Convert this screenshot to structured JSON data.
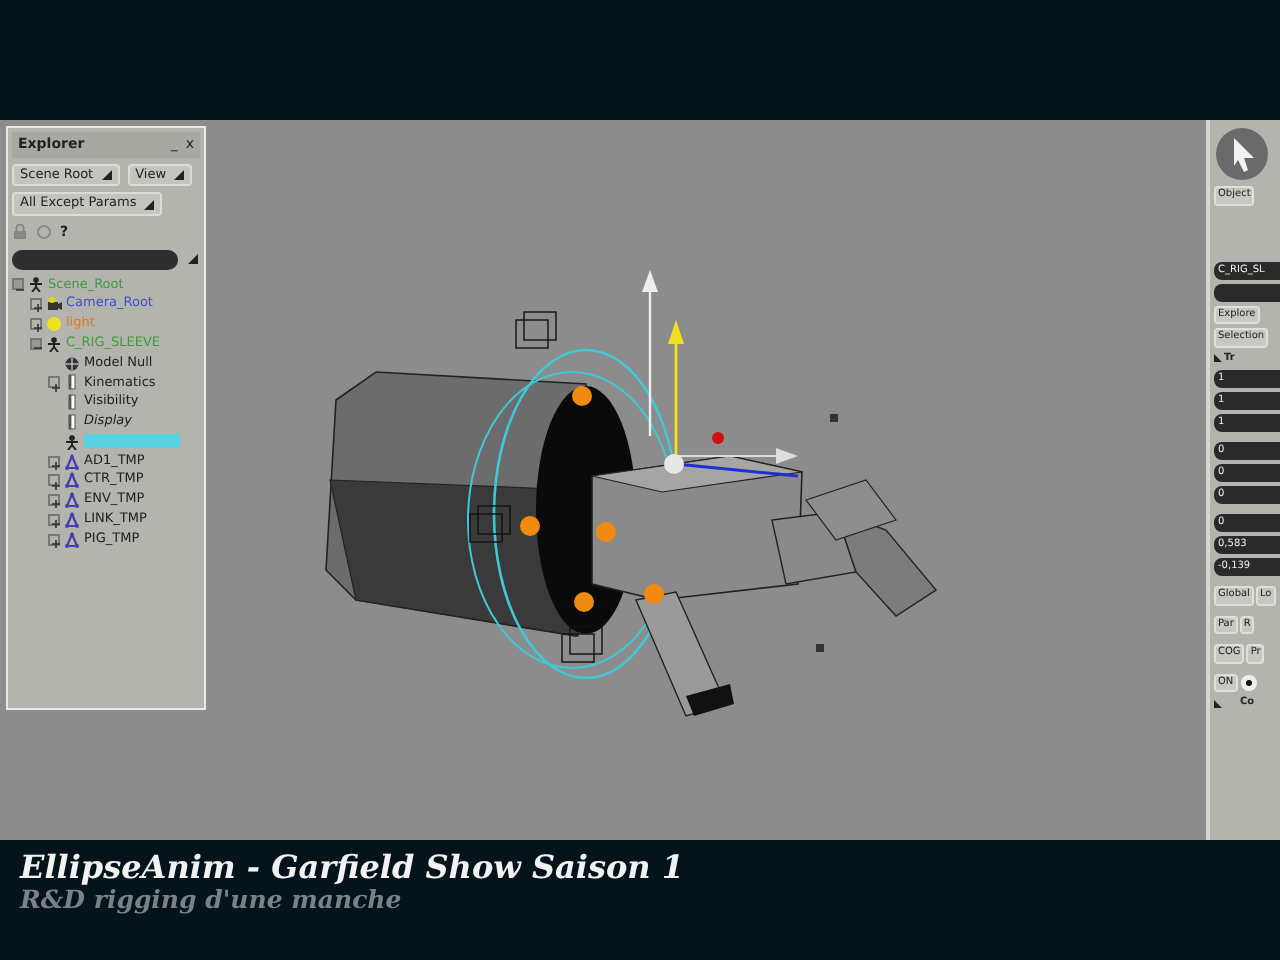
{
  "explorer": {
    "title": "Explorer",
    "minimize": "_",
    "close": "x",
    "buttons": [
      "Scene Root",
      "View",
      "All Except Params"
    ],
    "help": "?",
    "tree": [
      {
        "label": "Scene_Root",
        "kind": "null",
        "color": "#3f9a3f",
        "expanded": true,
        "children": [
          {
            "label": "Camera_Root",
            "kind": "camera",
            "color": "#4050c8",
            "expanded": false
          },
          {
            "label": "light",
            "kind": "light",
            "color": "#e07a20",
            "expanded": false
          },
          {
            "label": "C_RIG_SLEEVE",
            "kind": "null",
            "color": "#3f9a3f",
            "expanded": true,
            "children": [
              {
                "label": "Model Null",
                "kind": "model",
                "color": "#202020"
              },
              {
                "label": "Kinematics",
                "kind": "prop",
                "color": "#202020",
                "expanded": false
              },
              {
                "label": "Visibility",
                "kind": "prop",
                "color": "#202020"
              },
              {
                "label": "Display",
                "kind": "prop",
                "color": "#202020",
                "italic": true
              },
              {
                "kind": "null",
                "selected": true,
                "color": "#5ad0e0"
              },
              {
                "label": "AD1_TMP",
                "kind": "group",
                "color": "#202020",
                "expanded": false
              },
              {
                "label": "CTR_TMP",
                "kind": "group",
                "color": "#202020",
                "expanded": false
              },
              {
                "label": "ENV_TMP",
                "kind": "group",
                "color": "#202020",
                "expanded": false
              },
              {
                "label": "LINK_TMP",
                "kind": "group",
                "color": "#202020",
                "expanded": false
              },
              {
                "label": "PIG_TMP",
                "kind": "group",
                "color": "#202020",
                "expanded": false
              }
            ]
          }
        ]
      }
    ]
  },
  "panel": {
    "tab": "Object",
    "name_field": "C_RIG_SL",
    "buttons": [
      "Explore",
      "Selection"
    ],
    "section": "Tr",
    "values": [
      "1",
      "1",
      "1",
      "0",
      "0",
      "0",
      "0",
      "0,583",
      "-0,139"
    ],
    "toggles": [
      "Global",
      "Lo"
    ],
    "row2": [
      "Par",
      "R"
    ],
    "row3": [
      "COG",
      "Pr"
    ],
    "on": "ON",
    "section2": "Co"
  },
  "caption": {
    "title": "EllipseAnim - Garfield Show Saison 1",
    "subtitle": "R&D rigging d'une manche"
  }
}
